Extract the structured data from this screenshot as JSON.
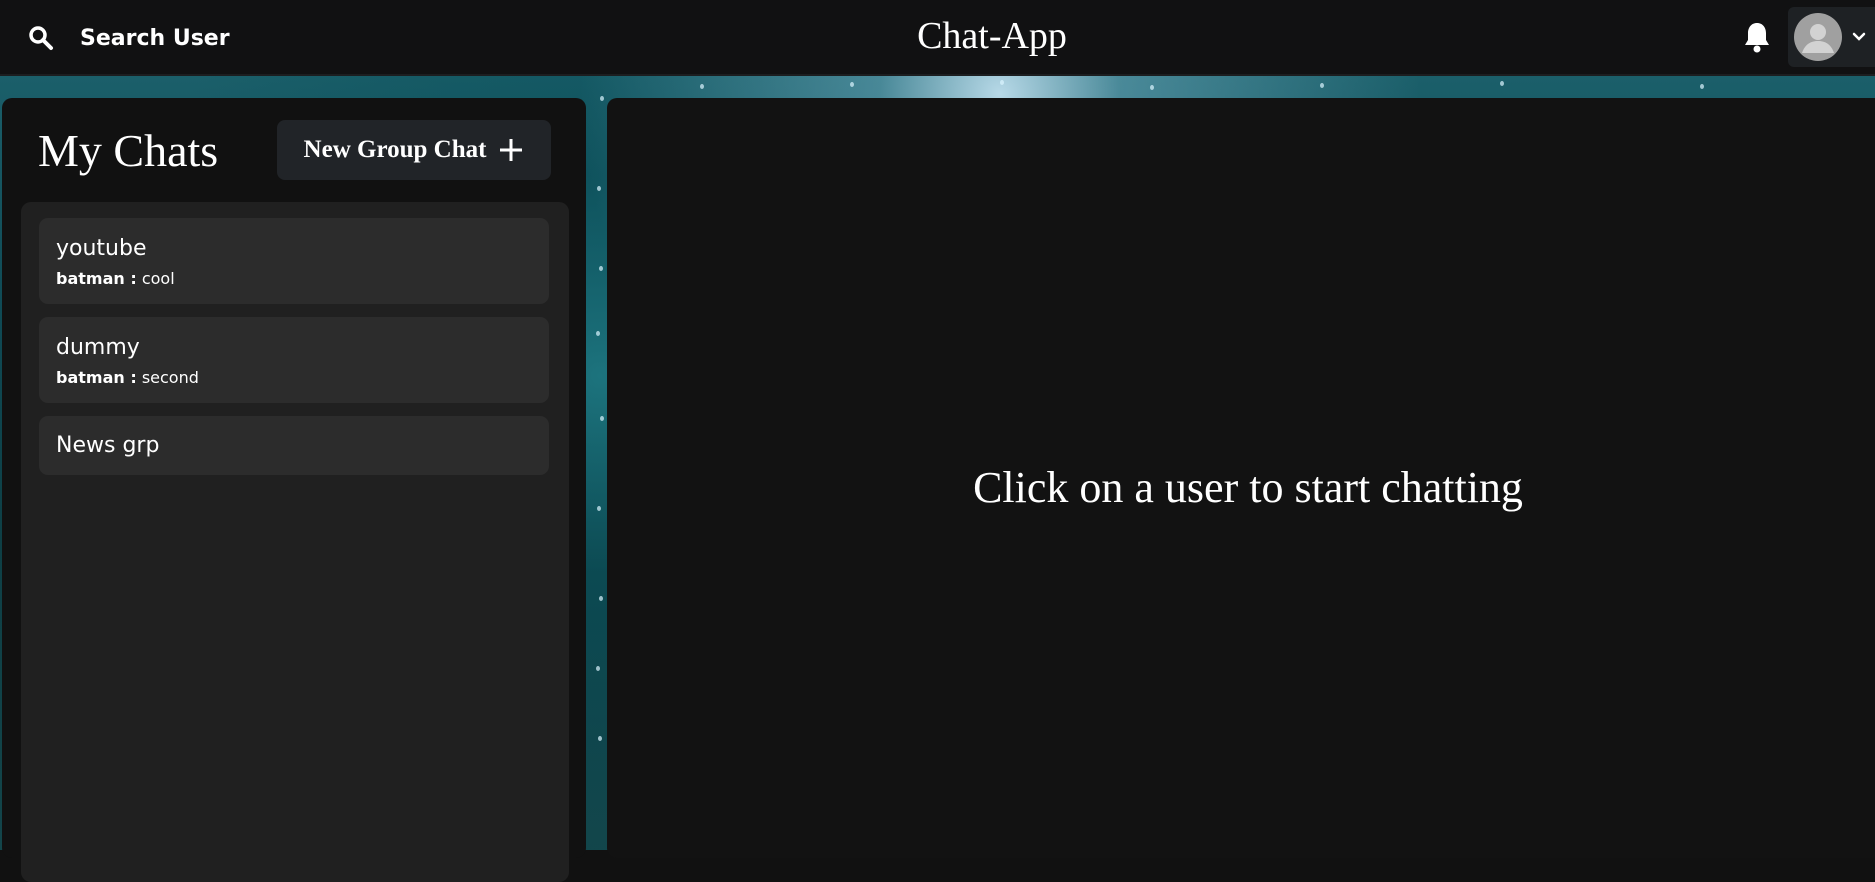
{
  "header": {
    "search_label": "Search User",
    "app_title": "Chat-App",
    "search_icon": "search-icon",
    "bell_icon": "bell-icon",
    "avatar_icon": "user-avatar-icon",
    "menu_icon": "chevron-down-icon"
  },
  "sidebar": {
    "title": "My Chats",
    "new_group_label": "New Group Chat",
    "new_group_icon": "plus-icon",
    "chats": [
      {
        "name": "youtube",
        "sender": "batman :",
        "message": "cool"
      },
      {
        "name": "dummy",
        "sender": "batman :",
        "message": "second"
      },
      {
        "name": "News grp"
      }
    ]
  },
  "main": {
    "placeholder": "Click on a user to start chatting"
  },
  "colors": {
    "background": "#111111",
    "panel": "#202020",
    "chat_item": "#2c2c2c",
    "button": "#212428",
    "text": "#ffffff"
  }
}
